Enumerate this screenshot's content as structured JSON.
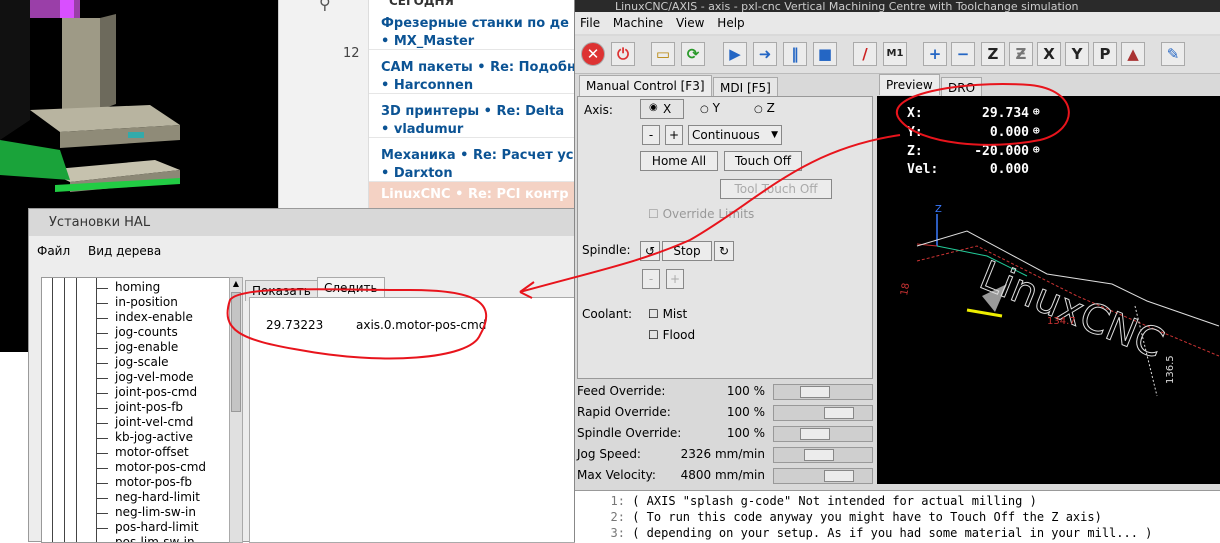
{
  "forum": {
    "header": "СЕГОДНЯ",
    "count": "12",
    "rows": [
      {
        "topic": "Фрезерные станки по де",
        "user": "MX_Master"
      },
      {
        "topic": "CAM пакеты • Re: Подобн",
        "user": "Harconnen"
      },
      {
        "topic": "3D принтеры • Re: Delta",
        "user": "vladumur"
      },
      {
        "topic": "Механика • Re: Расчет ус",
        "user": "Darxton"
      },
      {
        "topic": "LinuxCNC • Re: PCI контр",
        "user": ""
      }
    ]
  },
  "hal": {
    "title": "Установки HAL",
    "menu": [
      "Файл",
      "Вид дерева"
    ],
    "tree_items": [
      "homing",
      "in-position",
      "index-enable",
      "jog-counts",
      "jog-enable",
      "jog-scale",
      "jog-vel-mode",
      "joint-pos-cmd",
      "joint-pos-fb",
      "joint-vel-cmd",
      "kb-jog-active",
      "motor-offset",
      "motor-pos-cmd",
      "motor-pos-fb",
      "neg-hard-limit",
      "neg-lim-sw-in",
      "pos-hard-limit",
      "pos-lim-sw-in"
    ],
    "tabs": [
      "Показать",
      "Следить"
    ],
    "watch": {
      "value": "29.73223",
      "pin": "axis.0.motor-pos-cmd"
    }
  },
  "axis": {
    "title": "LinuxCNC/AXIS - axis - pxl-cnc Vertical Machining Centre with Toolchange simulation",
    "menu": [
      "File",
      "Machine",
      "View",
      "Help"
    ],
    "tabs": [
      "Manual Control [F3]",
      "MDI [F5]"
    ],
    "preview_tabs": [
      "Preview",
      "DRO"
    ],
    "axis_label": "Axis:",
    "axes": [
      "X",
      "Y",
      "Z"
    ],
    "minus": "-",
    "plus": "+",
    "jog_mode": "Continuous",
    "home_all": "Home All",
    "touch_off": "Touch Off",
    "tool_touch_off": "Tool Touch Off",
    "override_limits": "Override Limits",
    "spindle_label": "Spindle:",
    "stop": "Stop",
    "coolant_label": "Coolant:",
    "mist": "Mist",
    "flood": "Flood",
    "overrides": [
      {
        "label": "Feed Override:",
        "value": "100 %",
        "fraction": 0.4
      },
      {
        "label": "Rapid Override:",
        "value": "100 %",
        "fraction": 0.75
      },
      {
        "label": "Spindle Override:",
        "value": "100 %",
        "fraction": 0.4
      },
      {
        "label": "Jog Speed:",
        "value": "2326 mm/min",
        "fraction": 0.45
      },
      {
        "label": "Max Velocity:",
        "value": "4800 mm/min",
        "fraction": 0.75
      }
    ],
    "dro": [
      {
        "axis": "X:",
        "value": "29.734"
      },
      {
        "axis": "Y:",
        "value": "0.000"
      },
      {
        "axis": "Z:",
        "value": "-20.000"
      },
      {
        "axis": "Vel:",
        "value": "0.000"
      }
    ],
    "preview_text": "LinuxCNC",
    "dims": [
      "134.7",
      "136.5",
      "18"
    ],
    "gcode": [
      {
        "num": "1:",
        "text": "( AXIS \"splash g-code\" Not intended for actual milling )"
      },
      {
        "num": "2:",
        "text": "( To run this code anyway you might have to Touch Off the Z axis)"
      },
      {
        "num": "3:",
        "text": "( depending on your setup. As if you had some material in your mill... )"
      }
    ],
    "toolbar_glyphs": [
      "Z",
      "X",
      "Y",
      "P"
    ]
  },
  "colors": {
    "annotation": "#e8141c",
    "forum_link": "#0b5394",
    "selected_row": "#f4d2c4"
  }
}
